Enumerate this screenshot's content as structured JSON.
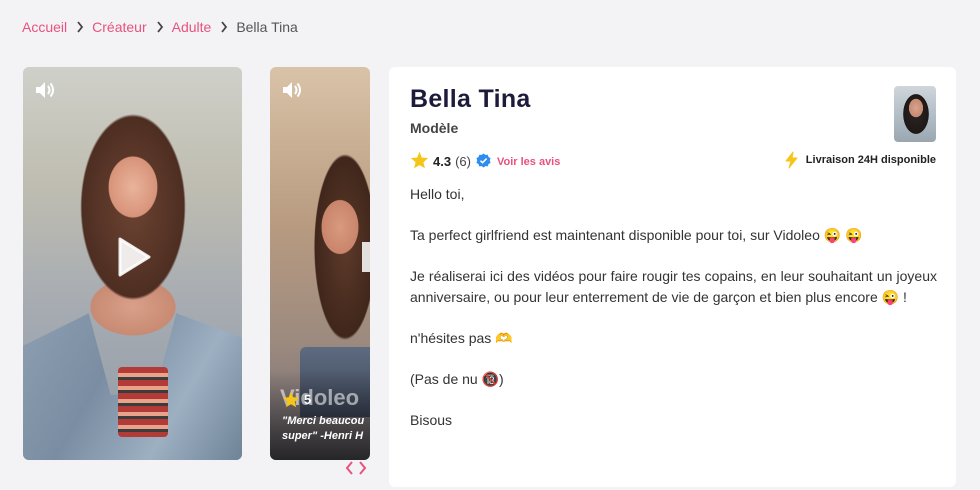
{
  "breadcrumb": {
    "items": [
      "Accueil",
      "Créateur",
      "Adulte"
    ],
    "current": "Bella Tina"
  },
  "videos": [
    {
      "has_sound": true,
      "has_play": true
    },
    {
      "has_sound": true,
      "rating": "5",
      "quote_line1": "\"Merci beaucou",
      "quote_line2": "super\" -Henri H",
      "watermark": "Vidoleo"
    }
  ],
  "profile": {
    "name": "Bella Tina",
    "role": "Modèle",
    "rating": "4.3",
    "review_count": "(6)",
    "reviews_link": "Voir les avis",
    "delivery": "Livraison 24H disponible",
    "description": [
      "Hello toi,",
      "Ta perfect girlfriend est maintenant disponible pour toi, sur Vidoleo 😜 😜",
      "Je réaliserai ici des vidéos pour faire rougir tes copains, en leur souhaitant un joyeux anniversaire, ou pour leur enterrement de vie de garçon et bien plus encore 😜 !",
      "n'hésites pas 🫶",
      "(Pas de nu 🔞)",
      "Bisous"
    ]
  },
  "colors": {
    "accent": "#e8527d",
    "star": "#f5c518",
    "verified": "#2f8cf0",
    "background": "#f3f3f6"
  },
  "icons": [
    "chevron-right-icon",
    "sound-icon",
    "play-icon",
    "star-icon",
    "verified-icon",
    "lightning-icon",
    "chevron-left-icon"
  ]
}
